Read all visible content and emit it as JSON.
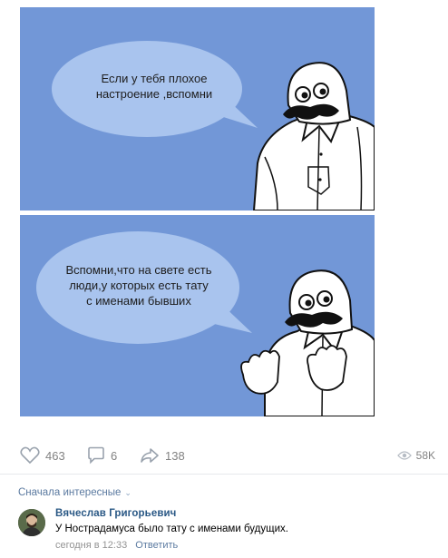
{
  "panels": [
    {
      "text": "Если у тебя плохое\nнастроение ,вспомни"
    },
    {
      "text": "Вспомни,что на свете есть\nлюди,у которых есть тату\nс именами бывших"
    }
  ],
  "actions": {
    "likes": "463",
    "comments": "6",
    "shares": "138",
    "views": "58K"
  },
  "comments_section": {
    "sort_label": "Сначала интересные",
    "comment": {
      "author": "Вячеслав Григорьевич",
      "text": "У Нострадамуса было тату с именами будущих.",
      "time": "сегодня в 12:33",
      "reply_label": "Ответить"
    }
  },
  "colors": {
    "panel_bg": "#7297d7",
    "bubble": "#a9c4ee",
    "link": "#2a5885",
    "muted": "#828282"
  }
}
